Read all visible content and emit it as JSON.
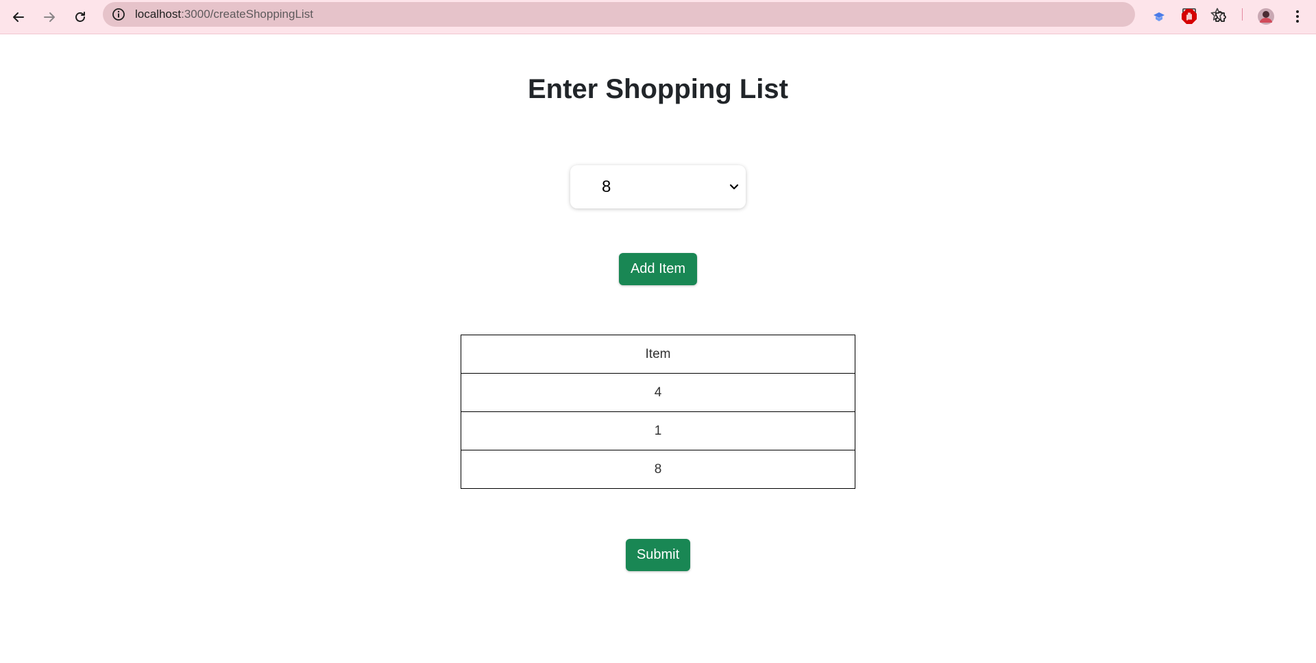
{
  "browser": {
    "url_host": "localhost",
    "url_path": ":3000/createShoppingList"
  },
  "page": {
    "title": "Enter Shopping List",
    "select": {
      "value": "8"
    },
    "add_button_label": "Add Item",
    "submit_button_label": "Submit",
    "table": {
      "header": "Item",
      "rows": [
        "4",
        "1",
        "8"
      ]
    }
  },
  "colors": {
    "chrome_bg": "#fde4ea",
    "omnibox_bg": "#e6c3ca",
    "button_green": "#198754"
  },
  "icons": {
    "back": "arrow-left-icon",
    "forward": "arrow-right-icon",
    "reload": "reload-icon",
    "site_info": "info-icon",
    "install": "install-app-icon",
    "bookmark": "star-icon",
    "extension1": "extension-blue-icon",
    "extension2": "stop-hand-icon",
    "extensions": "puzzle-icon",
    "profile": "avatar",
    "menu": "kebab-menu-icon"
  }
}
